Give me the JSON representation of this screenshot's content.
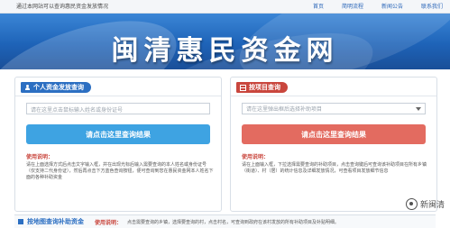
{
  "topbar": {
    "title": "通过本网站可以查询惠民资金发放情况",
    "nav": [
      "首页",
      "简明流程",
      "新闻公告",
      "联系我们"
    ]
  },
  "banner": {
    "title": "闽清惠民资金网"
  },
  "left_panel": {
    "tab": "个人资金发放查询",
    "input_placeholder": "请在这里点击鼠标输入姓名或身份证号",
    "button": "请点击这里查询结果",
    "usage_label": "使用说明：",
    "usage_text": "请在上面选择方式后点击文字输入框，并在出现光标后输入需要查询的本人姓名或身份证号（仅支持二代身份证），然后再点击下方蓝色查询按钮，便可查询到您在惠民资金网本人姓名下面的各种补助资金"
  },
  "right_panel": {
    "tab": "按项目查询",
    "select_placeholder": "请在这里弹出框后选择补助项目",
    "button": "请点击这里查询结果",
    "usage_label": "使用说明：",
    "usage_text": "请在上面输入框，下拉选择需要查询的补助项目，点击查询键后可查询该补助项目在所有乡镇（街道）、村（居）的统计信息及详细发放情况，可查看项目发放细节信息"
  },
  "bottom": {
    "tab": "按地图查询补助资金",
    "hint_label": "使用说明：",
    "hint": "点击需要查询的乡镇，选择要查询的村，点击村名，可查询到政府在该村发放的所有补助项目及补贴明细。"
  },
  "watermark": {
    "text": "新闽清"
  },
  "colors": {
    "accent_blue": "#2c6fc2",
    "accent_red": "#c9463d",
    "btn_blue": "#3ea3e2",
    "btn_red": "#e36b60"
  },
  "icons": {
    "left_tab": "person-icon",
    "right_tab": "grid-icon",
    "select": "chevron-down-icon",
    "watermark": "wechat-icon"
  }
}
